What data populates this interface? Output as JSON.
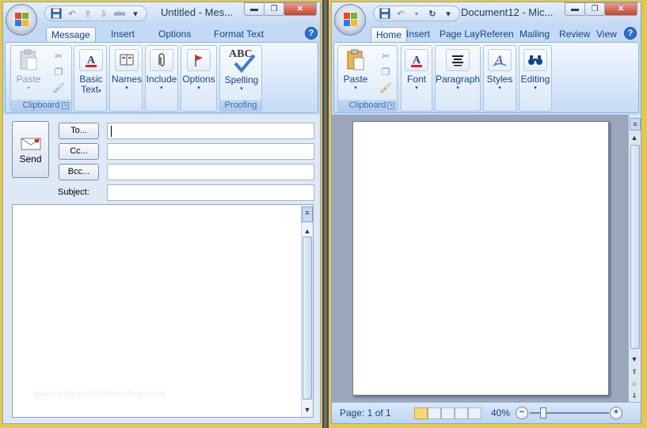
{
  "outlook": {
    "title": "Untitled - Mes...",
    "tabs": [
      "Message",
      "Insert",
      "Options",
      "Format Text"
    ],
    "groups": {
      "clipboard": {
        "label": "Clipboard",
        "paste": "Paste"
      },
      "basic_text": {
        "label_line1": "Basic",
        "label_line2": "Text"
      },
      "names": "Names",
      "include": "Include",
      "options": "Options",
      "proofing": {
        "label": "Proofing",
        "spelling": "Spelling",
        "abc": "ABC"
      }
    },
    "send": "Send",
    "to": "To...",
    "cc": "Cc...",
    "bcc": "Bcc...",
    "subject_label": "Subject:",
    "to_value": "",
    "cc_value": "",
    "bcc_value": "",
    "subject_value": "",
    "watermark": "www.heritagechristiancollege.com"
  },
  "word": {
    "title": "Document12 - Mic...",
    "tabs": [
      "Home",
      "Insert",
      "Page Lay",
      "Referen",
      "Mailing",
      "Review",
      "View"
    ],
    "groups": {
      "clipboard": {
        "label": "Clipboard",
        "paste": "Paste"
      },
      "font": "Font",
      "paragraph": "Paragraph",
      "styles": "Styles",
      "editing": "Editing"
    },
    "status": {
      "page": "Page: 1 of 1",
      "zoom": "40%"
    },
    "zoom_level": 0.4
  },
  "icons": {
    "save": "save-icon",
    "undo": "undo-icon",
    "redo": "redo-icon",
    "help": "help-icon"
  },
  "colors": {
    "accent": "#15428b",
    "ribbon": "#c4daf4",
    "desktop": "#e4c84a"
  }
}
